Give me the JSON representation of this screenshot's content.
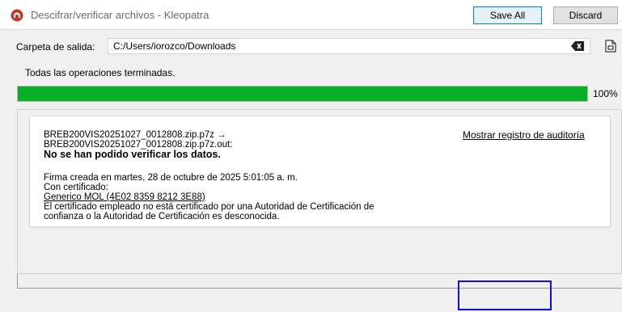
{
  "window": {
    "title": "Descifrar/verificar archivos - Kleopatra",
    "help_label": "?",
    "close_label": "×",
    "icon": "kleopatra-app-icon"
  },
  "output": {
    "label": "Carpeta de salida:",
    "value": "C:/Users/iorozco/Downloads",
    "clear_icon": "backspace-clear-icon",
    "browse_icon": "folder-browse-icon"
  },
  "status": "Todas las operaciones terminadas.",
  "progress": {
    "value": 1.0,
    "label": "100%",
    "color": "#06b025"
  },
  "result": {
    "file_line1": "BREB200VIS20251027_0012808.zip.p7z →",
    "file_line2": "BREB200VIS20251027_0012808.zip.p7z.out:",
    "error_title": "No se han podido verificar los datos.",
    "signature_line": "Firma creada en martes, 28 de octubre de 2025 5:01:05 a. m.",
    "cert_label": "Con certificado:",
    "cert_name": "Generico MOL (4E02 8359 8212 3E88)",
    "warning_line1": "El certificado empleado no está certificado por una Autoridad de Certificación de",
    "warning_line2": "confianza o la Autoridad de Certificación es desconocida.",
    "audit_link": "Mostrar registro de auditoría"
  },
  "buttons": {
    "save_all": "Save All",
    "discard": "Discard"
  },
  "colors": {
    "highlight": "#1010d8",
    "app_icon": "#c0392b"
  }
}
